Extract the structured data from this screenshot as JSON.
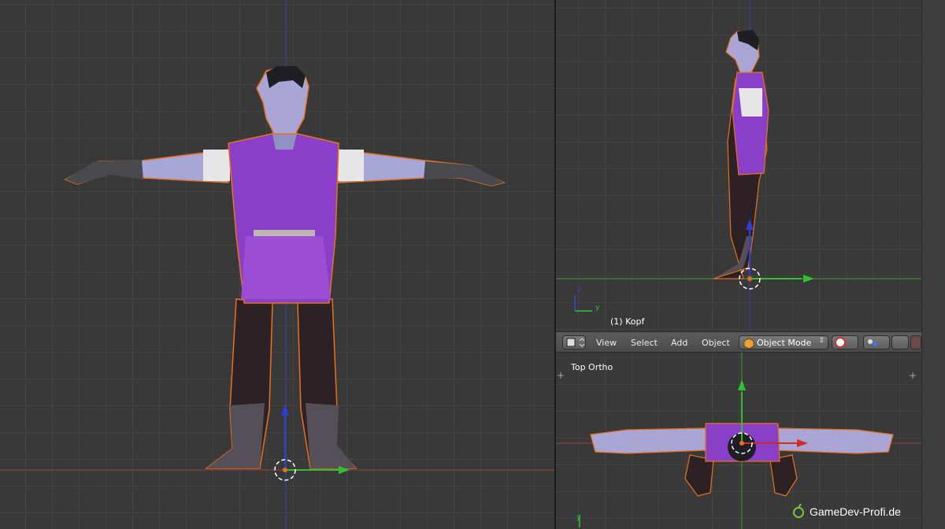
{
  "viewports": {
    "front": {
      "label": ""
    },
    "side": {
      "object_label": "(1) Kopf",
      "axis_z": "z",
      "axis_y": "y"
    },
    "top": {
      "label": "Top Ortho",
      "axis_y": "y"
    }
  },
  "header": {
    "menus": [
      "View",
      "Select",
      "Add",
      "Object"
    ],
    "mode": "Object Mode"
  },
  "watermark": "GameDev-Profi.de",
  "colors": {
    "background": "#393939",
    "grid": "#444444",
    "x_axis": "#b33b3b",
    "y_axis": "#3ba23b",
    "z_axis": "#2d42c6",
    "selection_outline": "#e8711d",
    "tunic": "#8a3fc8",
    "skin": "#a9a6d6"
  },
  "icons": [
    "view3d-icon",
    "mode-cube-icon",
    "shading-icon",
    "pivot-icon",
    "plus-icon",
    "logo-icon"
  ]
}
